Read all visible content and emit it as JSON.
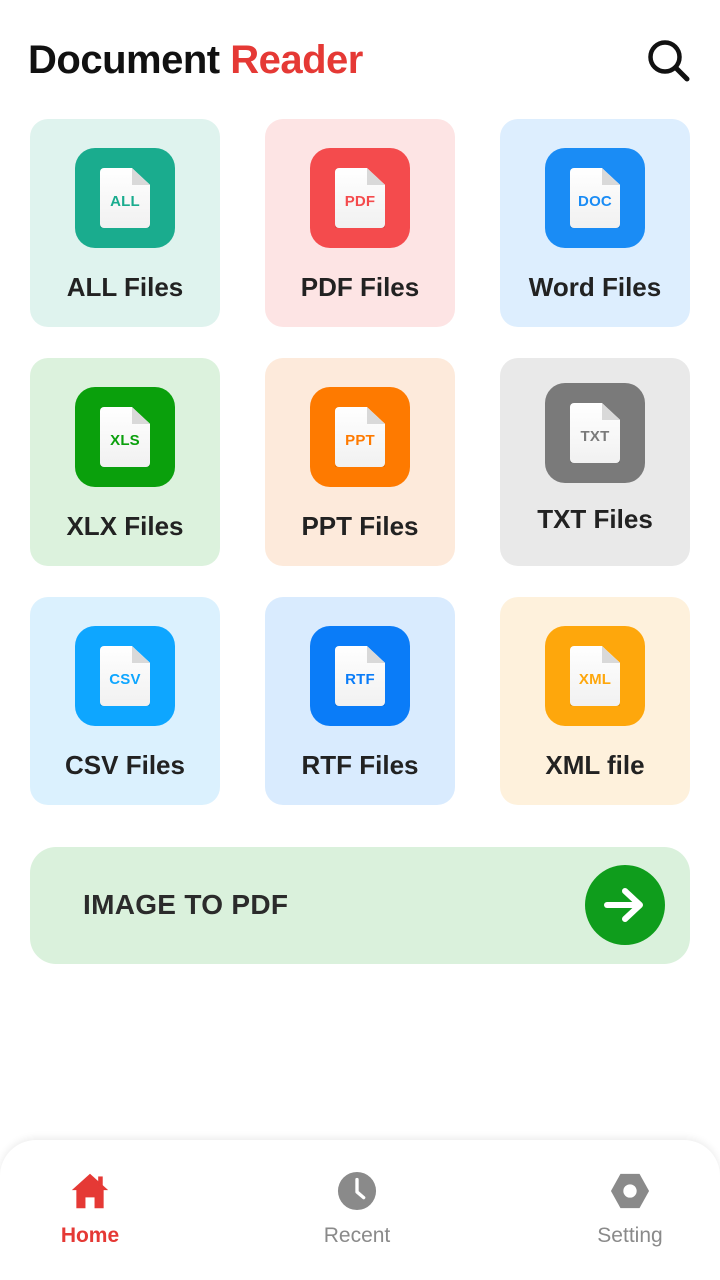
{
  "header": {
    "title_part1": "Document",
    "title_part2": "Reader",
    "accent_color": "#e53935",
    "search_icon": "search-icon"
  },
  "tiles": [
    {
      "label": "ALL Files",
      "badge": "ALL",
      "icon_color": "#1aac8e",
      "badge_color": "#1aac8e",
      "bg": "#dff3ee"
    },
    {
      "label": "PDF Files",
      "badge": "PDF",
      "icon_color": "#f44b4d",
      "badge_color": "#f44b4d",
      "bg": "#fde4e4"
    },
    {
      "label": "Word Files",
      "badge": "DOC",
      "icon_color": "#1a8cf5",
      "badge_color": "#1a8cf5",
      "bg": "#ddeefe"
    },
    {
      "label": "XLX Files",
      "badge": "XLS",
      "icon_color": "#0aa00c",
      "badge_color": "#0aa00c",
      "bg": "#dcf2dd"
    },
    {
      "label": "PPT Files",
      "badge": "PPT",
      "icon_color": "#fe7a00",
      "badge_color": "#fe7a00",
      "bg": "#fdeadb"
    },
    {
      "label": "TXT Files",
      "badge": "TXT",
      "icon_color": "#7a7a7a",
      "badge_color": "#7a7a7a",
      "bg": "#e9e9e9"
    },
    {
      "label": "CSV Files",
      "badge": "CSV",
      "icon_color": "#0ea6ff",
      "badge_color": "#0ea6ff",
      "bg": "#dbf1fe"
    },
    {
      "label": "RTF Files",
      "badge": "RTF",
      "icon_color": "#0a7cf8",
      "badge_color": "#0a7cf8",
      "bg": "#d9ebfe"
    },
    {
      "label": "XML file",
      "badge": "XML",
      "icon_color": "#fea70c",
      "badge_color": "#fea70c",
      "bg": "#fef1dc"
    }
  ],
  "banner": {
    "label": "IMAGE TO PDF",
    "arrow_icon": "arrow-right-icon",
    "bg": "#daf1dc",
    "arrow_bg": "#0f9d1c"
  },
  "nav": {
    "active_color": "#e53935",
    "inactive_color": "#8a8a8a",
    "items": [
      {
        "label": "Home",
        "icon": "home-icon",
        "active": true
      },
      {
        "label": "Recent",
        "icon": "clock-icon",
        "active": false
      },
      {
        "label": "Setting",
        "icon": "hexagon-settings-icon",
        "active": false
      }
    ]
  }
}
